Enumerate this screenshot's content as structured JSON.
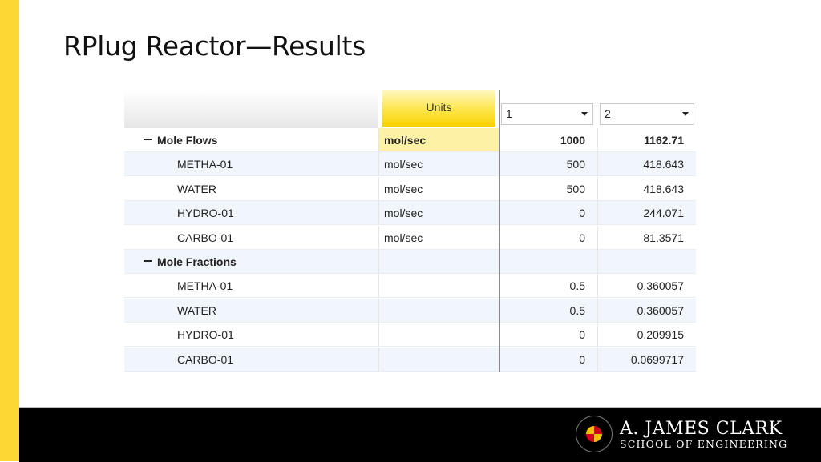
{
  "slide": {
    "title": "RPlug Reactor—Results",
    "accent_color": "#fdd835",
    "footer_color": "#000000"
  },
  "grid": {
    "header": {
      "units_label": "Units",
      "column_selectors": [
        {
          "value": "1"
        },
        {
          "value": "2"
        }
      ]
    },
    "rows": [
      {
        "type": "group",
        "name": "Mole Flows",
        "unit": "mol/sec",
        "v1": "1000",
        "v2": "1162.71"
      },
      {
        "type": "child",
        "name": "METHA-01",
        "unit": "mol/sec",
        "v1": "500",
        "v2": "418.643"
      },
      {
        "type": "child",
        "name": "WATER",
        "unit": "mol/sec",
        "v1": "500",
        "v2": "418.643"
      },
      {
        "type": "child",
        "name": "HYDRO-01",
        "unit": "mol/sec",
        "v1": "0",
        "v2": "244.071"
      },
      {
        "type": "child",
        "name": "CARBO-01",
        "unit": "mol/sec",
        "v1": "0",
        "v2": "81.3571"
      },
      {
        "type": "group",
        "name": "Mole Fractions",
        "unit": "",
        "v1": "",
        "v2": ""
      },
      {
        "type": "child",
        "name": "METHA-01",
        "unit": "",
        "v1": "0.5",
        "v2": "0.360057"
      },
      {
        "type": "child",
        "name": "WATER",
        "unit": "",
        "v1": "0.5",
        "v2": "0.360057"
      },
      {
        "type": "child",
        "name": "HYDRO-01",
        "unit": "",
        "v1": "0",
        "v2": "0.209915"
      },
      {
        "type": "child",
        "name": "CARBO-01",
        "unit": "",
        "v1": "0",
        "v2": "0.0699717"
      }
    ]
  },
  "logo": {
    "line1": "A. JAMES CLARK",
    "line2": "SCHOOL OF ENGINEERING",
    "seal": "university-of-maryland-seal-icon"
  }
}
